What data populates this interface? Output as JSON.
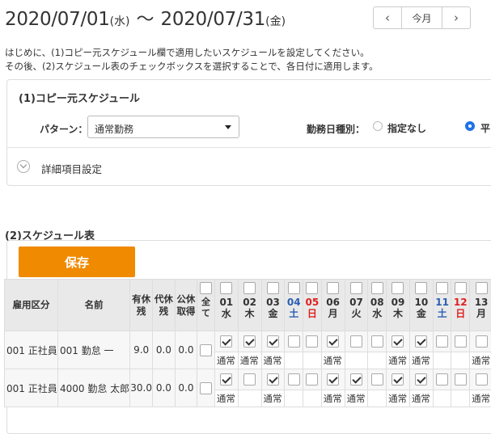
{
  "header": {
    "start_date": "2020/07/01",
    "start_dow": "(水)",
    "tilde": "〜",
    "end_date": "2020/07/31",
    "end_dow": "(金)",
    "prev_icon": "chevron-left-icon",
    "today_label": "今月",
    "next_icon": "chevron-right-icon"
  },
  "intro": {
    "line1": "はじめに、(1)コピー元スケジュール欄で適用したいスケジュールを設定してください。",
    "line2": "その後、(2)スケジュール表のチェックボックスを選択することで、各日付に適用します。"
  },
  "copy_source": {
    "title": "(1)コピー元スケジュール",
    "pattern_label": "パターン：",
    "pattern_value": "通常勤務",
    "daytype_label": "勤務日種別：",
    "option_none": "指定なし",
    "option_weekday": "平",
    "selected_option": "平",
    "detail_label": "詳細項目設定"
  },
  "schedule": {
    "title": "(2)スケジュール表",
    "save_label": "保存",
    "save_color": "#f08a00",
    "columns": {
      "employment": "雇用区分",
      "name": "名前",
      "paid_1": "有休",
      "paid_2": "残",
      "subst_1": "代休",
      "subst_2": "残",
      "public_1": "公休",
      "public_2": "取得",
      "all": "全て"
    },
    "days": [
      {
        "d": "01",
        "w": "水",
        "type": "weekday"
      },
      {
        "d": "02",
        "w": "木",
        "type": "weekday"
      },
      {
        "d": "03",
        "w": "金",
        "type": "weekday"
      },
      {
        "d": "04",
        "w": "土",
        "type": "sat"
      },
      {
        "d": "05",
        "w": "日",
        "type": "sun"
      },
      {
        "d": "06",
        "w": "月",
        "type": "weekday"
      },
      {
        "d": "07",
        "w": "火",
        "type": "weekday"
      },
      {
        "d": "08",
        "w": "水",
        "type": "weekday"
      },
      {
        "d": "09",
        "w": "木",
        "type": "weekday"
      },
      {
        "d": "10",
        "w": "金",
        "type": "weekday"
      },
      {
        "d": "11",
        "w": "土",
        "type": "sat"
      },
      {
        "d": "12",
        "w": "日",
        "type": "sun"
      },
      {
        "d": "13",
        "w": "月",
        "type": "weekday"
      }
    ],
    "rows": [
      {
        "employment": "001 正社員",
        "name": "001 勤怠 一",
        "paid": "9.0",
        "subst": "0.0",
        "public": "0.0",
        "checks": [
          true,
          true,
          true,
          false,
          false,
          true,
          false,
          false,
          true,
          true,
          false,
          false,
          false
        ],
        "types": [
          "通常",
          "通常",
          "通常",
          "",
          "",
          "通常",
          "",
          "",
          "通常",
          "通常",
          "",
          "",
          "通常"
        ]
      },
      {
        "employment": "001 正社員",
        "name": "4000 勤怠 太郎",
        "paid": "30.0",
        "subst": "0.0",
        "public": "0.0",
        "checks": [
          true,
          false,
          true,
          false,
          false,
          true,
          true,
          false,
          true,
          true,
          false,
          false,
          false
        ],
        "types": [
          "通常",
          "",
          "通常",
          "",
          "",
          "通常",
          "通常",
          "",
          "通常",
          "通常",
          "",
          "",
          "通常"
        ]
      }
    ],
    "colors": {
      "saturday": "#2c5fb3",
      "sunday": "#e02020",
      "header_bg": "#e9e9e9"
    }
  }
}
